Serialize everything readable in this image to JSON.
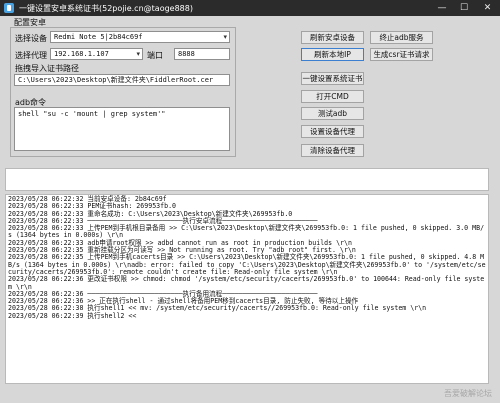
{
  "window": {
    "title": "一键设置安卓系统证书(52pojie.cn@taoge888)",
    "controls": [
      "—",
      "☐",
      "✕"
    ]
  },
  "config": {
    "group_title": "配置安卓",
    "device_label": "选择设备",
    "device_value": "Redmi Note 5|2b84c69f",
    "proxy_label": "选择代理",
    "proxy_value": "192.168.1.107",
    "port_label": "端口",
    "port_value": "8888",
    "cert_path_label": "拖拽导入证书路径",
    "cert_path_value": "C:\\Users\\2023\\Desktop\\新建文件夹\\FiddlerRoot.cer",
    "adb_label": "adb命令",
    "adb_value": "shell \"su -c 'mount | grep system'\""
  },
  "buttons": {
    "refresh_device": "刷新安卓设备",
    "kill_adb": "终止adb服务",
    "refresh_ip": "刷新本地IP",
    "gen_csr": "生成csr证书请求",
    "set_cert": "一键设置系统证书",
    "open_cmd": "打开CMD",
    "test_adb": "测试adb",
    "set_proxy": "设置设备代理",
    "clear_proxy": "清除设备代理"
  },
  "log": {
    "lines": [
      "2023/05/28 06:22:32 当前安卓设备: 2b84c69f",
      "2023/05/28 06:22:33 PEM证书hash: 269953fb.0",
      "2023/05/28 06:22:33 重命名成功: C:\\Users\\2023\\Desktop\\新建文件夹\\269953fb.0",
      "2023/05/28 06:22:33 ────────────────────────执行安卓流程────────────────────────",
      "2023/05/28 06:22:33 上传PEM到手机根目录备用 >> C:\\Users\\2023\\Desktop\\新建文件夹\\269953fb.0: 1 file pushed, 0 skipped. 3.0 MB/s (1364 bytes in 0.000s) \\r\\n",
      "2023/05/28 06:22:33 adb申请root权限 >> adbd cannot run as root in production builds \\r\\n",
      "2023/05/28 06:22:35 重新挂载分区为可读写 >> Not running as root. Try \"adb root\" first. \\r\\n",
      "2023/05/28 06:22:35 上传PEM到手机cacerts目录 >> C:\\Users\\2023\\Desktop\\新建文件夹\\269953fb.0: 1 file pushed, 0 skipped. 4.8 MB/s (1364 bytes in 0.000s) \\r\\nadb: error: failed to copy 'C:\\Users\\2023\\Desktop\\新建文件夹\\269953fb.0' to '/system/etc/security/cacerts/269953fb.0': remote couldn't create file: Read-only file system \\r\\n",
      "2023/05/28 06:22:36 更改证书权限 >> chmod: chmod '/system/etc/security/cacerts/269953fb.0' to 100644: Read-only file system \\r\\n",
      "2023/05/28 06:22:36 ────────────────────────执行备用流程────────────────────────",
      "2023/05/28 06:22:36 >> 正在执行shell - 通过shell将备用PEM移到cacerts目录, 防止失败, 等待以上操作",
      "2023/05/28 06:22:38 执行shell1 << mv: /system/etc/security/cacerts//269953fb.0: Read-only file system \\r\\n",
      "2023/05/28 06:22:39 执行shell2 <<"
    ]
  },
  "watermark": "吾爱破解论坛"
}
